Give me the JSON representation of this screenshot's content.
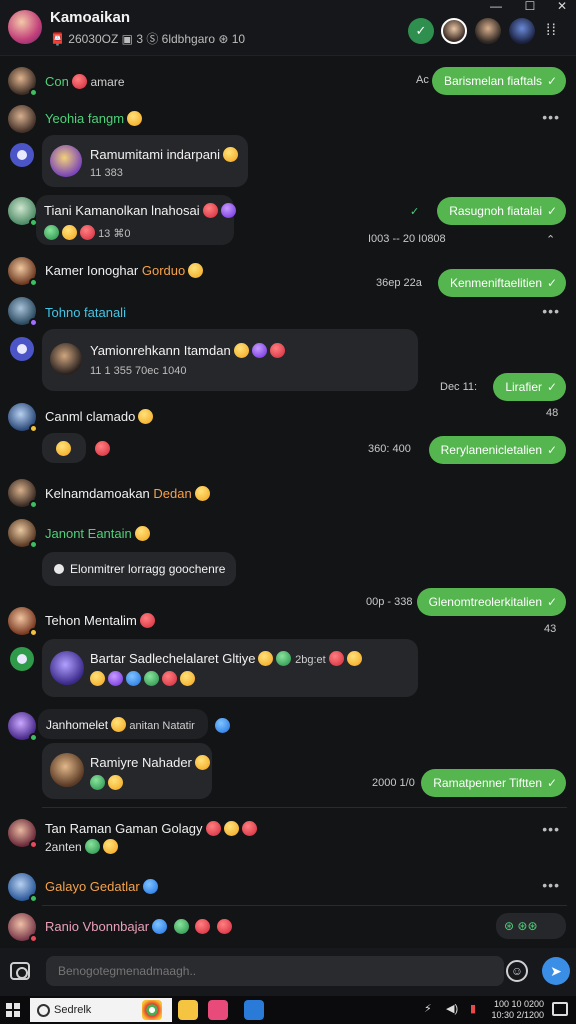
{
  "window": {
    "title": "Kamoaikan",
    "subtitle": "📮 26030OZ ▣ 3 Ⓢ 6ldbhgaro ⊛ 10",
    "controls": [
      "—",
      "☐",
      "✕"
    ]
  },
  "header_icons": [
    "check-icon",
    "contact-avatar",
    "contact-avatar",
    "contact-avatar",
    "more-icon"
  ],
  "messages": [
    {
      "name": "Con",
      "suffix": "amare",
      "time": "Ac",
      "bubble": "Barismelan fiaftals"
    },
    {
      "name": "Yeohia fangm",
      "dots": "•••"
    },
    {
      "card_title": "Ramumitami indarpani",
      "card_sub": "11 383"
    },
    {
      "name": "Tiani Kamanolkan lnahosai",
      "sub": "13 ⌘0",
      "time": "I003 -- 20   I0808",
      "bubble": "Rasugnoh fiatalai"
    },
    {
      "name": "Kamer Ionoghar",
      "accent": "Gorduo",
      "time": "36ep 22a",
      "bubble": "Kenmeniftaelitien"
    },
    {
      "name": "Tohno fatanali",
      "dots": "•••"
    },
    {
      "card_title": "Yamionrehkann Itamdan",
      "card_sub": "11 1 355  70ec 1040"
    },
    {
      "time": "Dec 11:",
      "bubble": "Lirafier",
      "sub_time": "48"
    },
    {
      "name": "Canml clamado"
    },
    {
      "time": "360: 400",
      "bubble": "Rerylanenicletalien"
    },
    {
      "name": "Kelnamdamoakan",
      "accent": "Dedan"
    },
    {
      "name": "Janont Eantain"
    },
    {
      "card_title": "Elonmitrer lorragg goochenre"
    },
    {
      "time": "00p - 338",
      "bubble": "Glenomtreolerkitalien",
      "sub_time": "43"
    },
    {
      "name": "Tehon Mentalim"
    },
    {
      "card_title": "Bartar Sadlechelalaret Gltiye",
      "card_extra": "2bg:et"
    },
    {
      "name": "Janhomelet",
      "accent": "anitan Natatir"
    },
    {
      "card_title": "Ramiyre Nahader"
    },
    {
      "time": "2000 1/0",
      "bubble": "Ramatpenner Tiftten"
    },
    {
      "name": "Tan Raman Gaman Golagy",
      "sub": "2anten",
      "dots": "•••"
    },
    {
      "name": "Galayo Gedatlar",
      "dots": "•••"
    },
    {
      "name": "Ranio Vbonnbajar",
      "reactions": "⊛ ⊛⊛"
    }
  ],
  "input": {
    "placeholder": "Benogotegmenadmaagh.."
  },
  "taskbar": {
    "search": "Sedrelk",
    "clock_line1": "100 10 0200",
    "clock_line2": "10:30 2/1200"
  }
}
